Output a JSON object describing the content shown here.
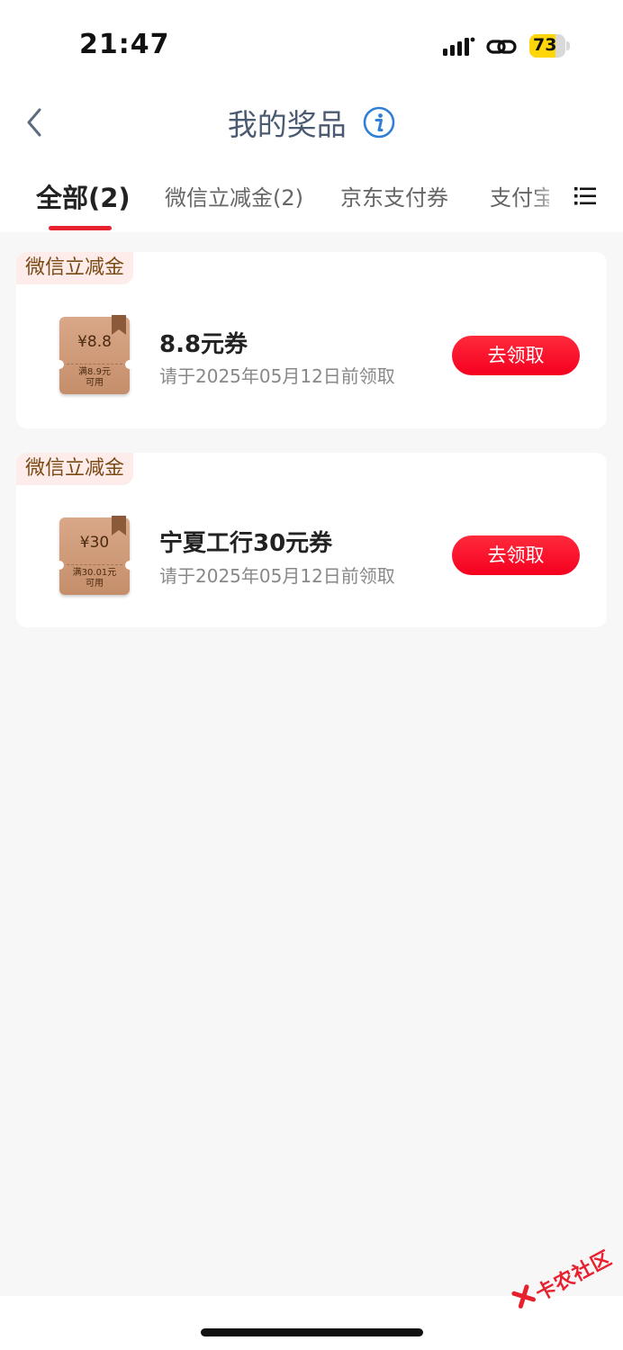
{
  "status": {
    "time": "21:47",
    "battery": "73",
    "battery_level": 0.73
  },
  "header": {
    "title": "我的奖品"
  },
  "tabs": [
    {
      "label": "全部(2)",
      "active": true
    },
    {
      "label": "微信立减金(2)",
      "active": false
    },
    {
      "label": "京东支付券",
      "active": false
    },
    {
      "label": "支付宝",
      "active": false
    }
  ],
  "prizes": [
    {
      "tag": "微信立减金",
      "coupon_amount": "¥8.8",
      "coupon_condition_1": "满8.9元",
      "coupon_condition_2": "可用",
      "title": "8.8元券",
      "subtitle": "请于2025年05月12日前领取",
      "button": "去领取"
    },
    {
      "tag": "微信立减金",
      "coupon_amount": "¥30",
      "coupon_condition_1": "满30.01元",
      "coupon_condition_2": "可用",
      "title": "宁夏工行30元券",
      "subtitle": "请于2025年05月12日前领取",
      "button": "去领取"
    }
  ],
  "watermark": "卡农社区",
  "colors": {
    "accent": "#e8212f",
    "button": "#f5001f",
    "title": "#4a5a70",
    "tag_bg": "#fdecea",
    "battery": "#ffd60a"
  }
}
